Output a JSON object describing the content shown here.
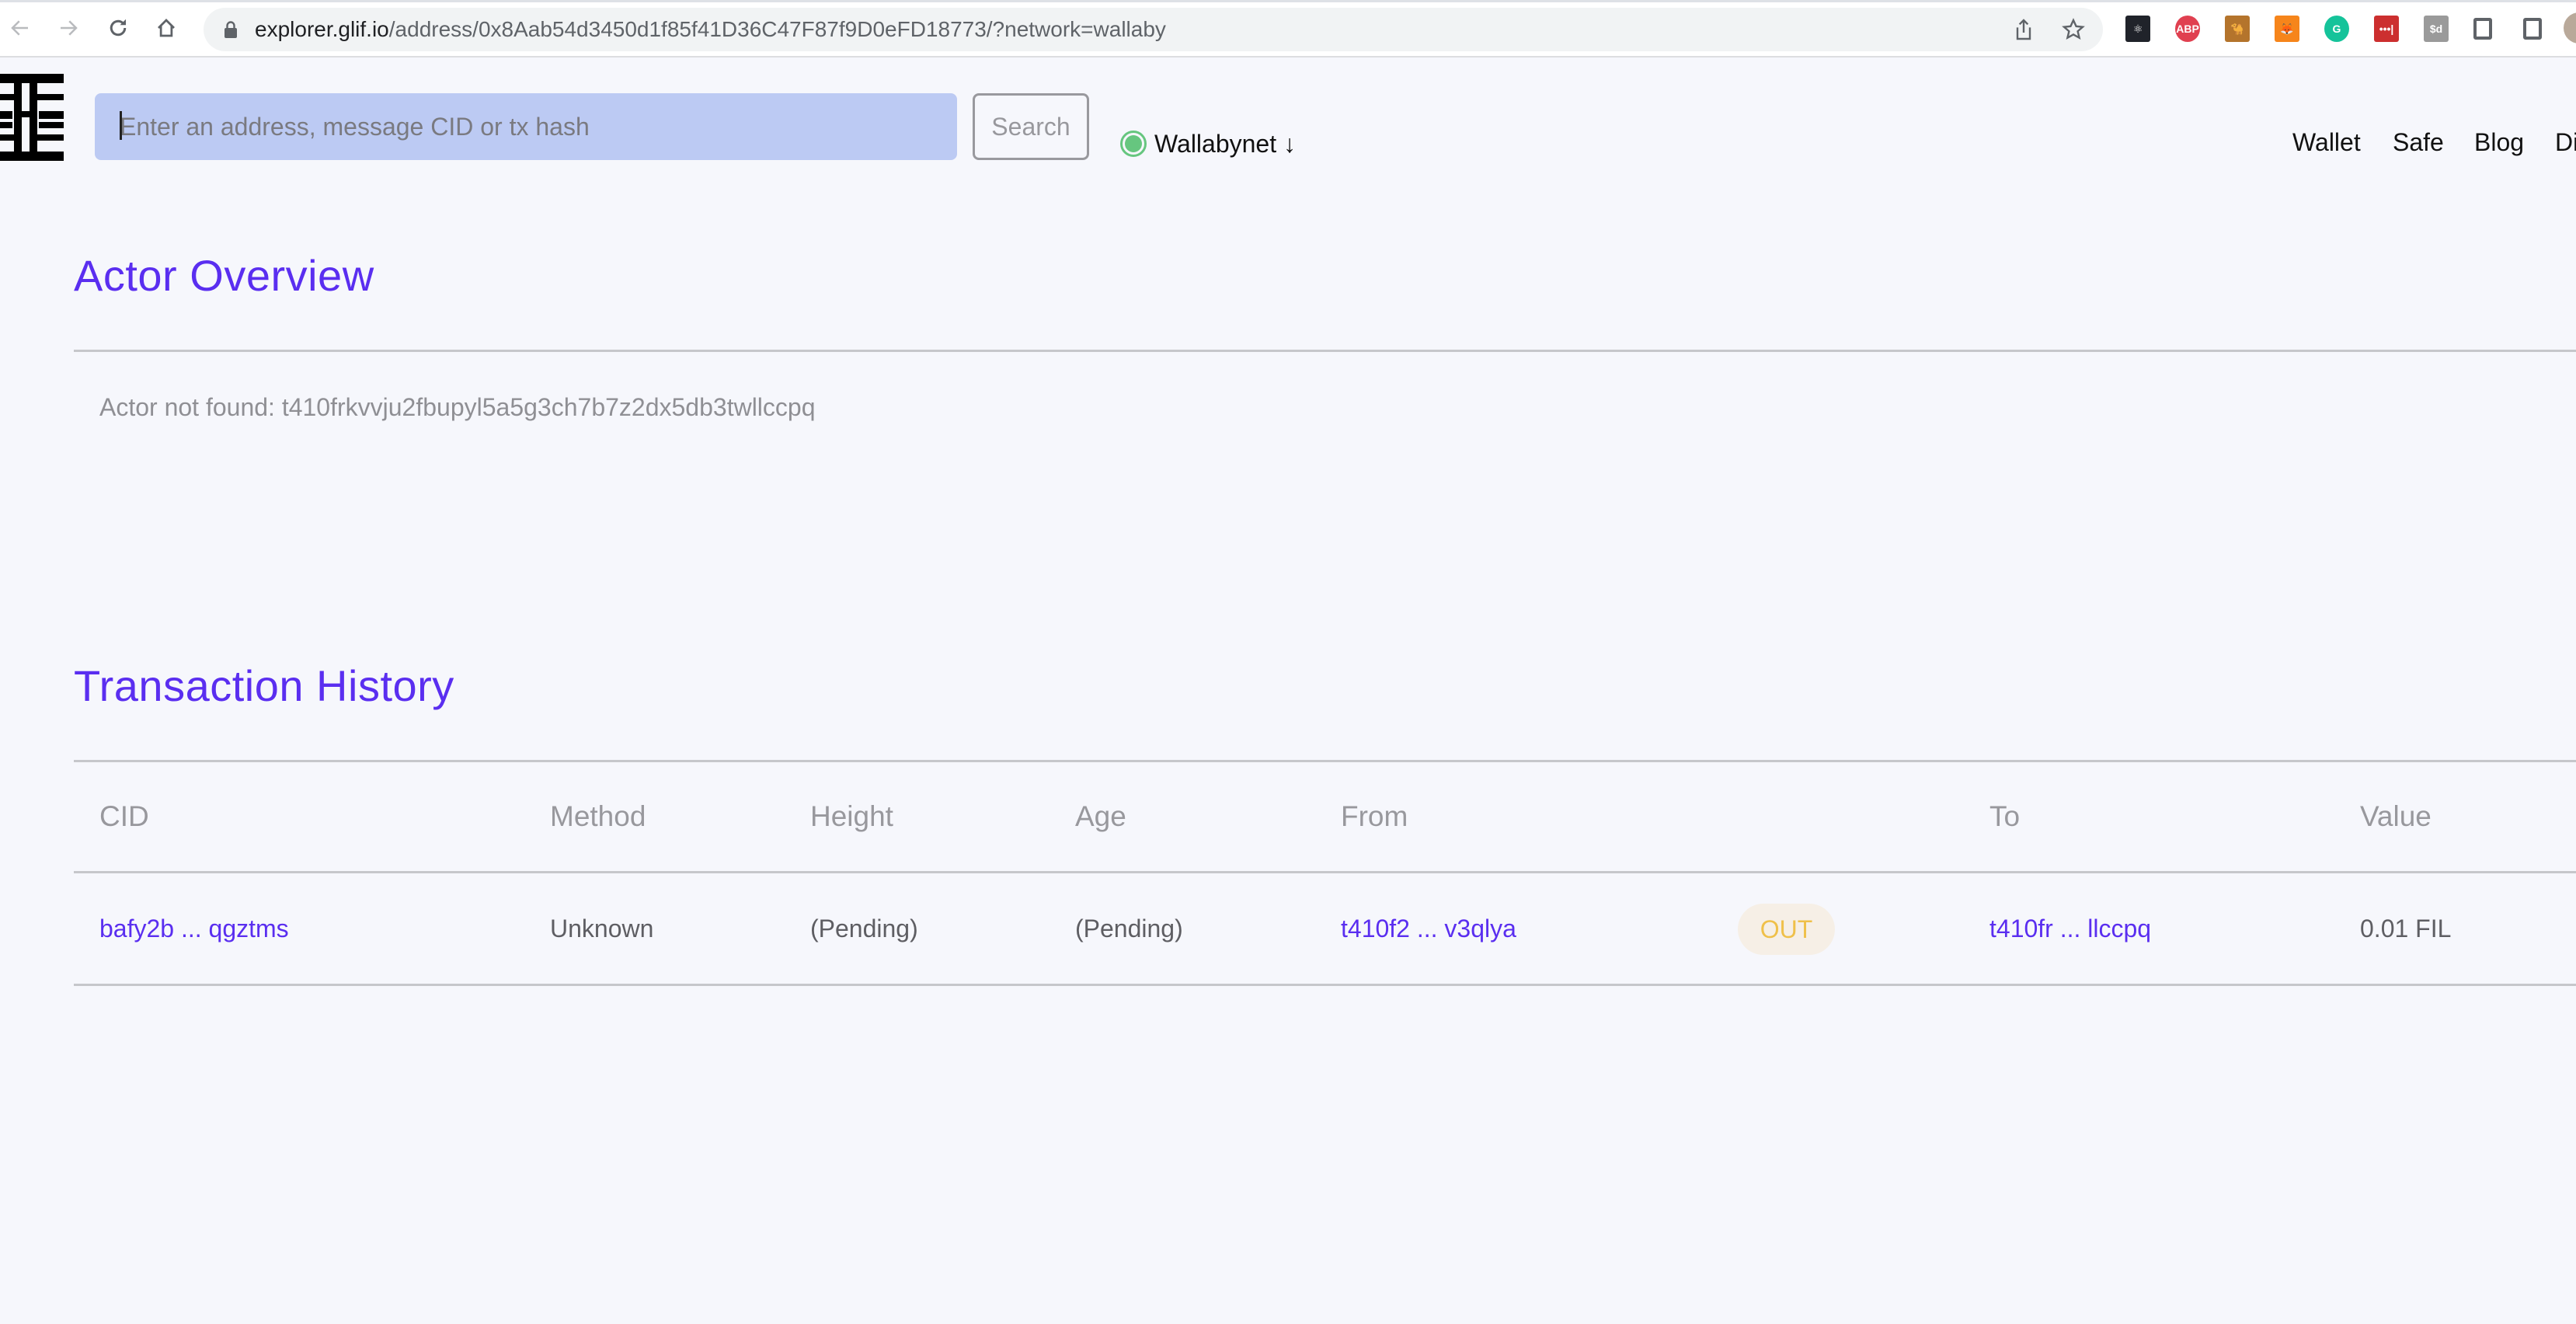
{
  "browser": {
    "url_host": "explorer.glif.io",
    "url_path": "/address/0x8Aab54d3450d1f85f41D36C47F87f9D0eFD18773/?network=wallaby",
    "extensions": [
      {
        "name": "react-devtools",
        "label": "⚛",
        "color": "#20232a"
      },
      {
        "name": "adblock-plus",
        "label": "ABP",
        "color": "#e04050"
      },
      {
        "name": "camel-notebook",
        "label": "🐪",
        "color": "#b4742c"
      },
      {
        "name": "metamask",
        "label": "🦊",
        "color": "#f6851b"
      },
      {
        "name": "grammarly",
        "label": "G",
        "color": "#15c39a"
      },
      {
        "name": "lastpass",
        "label": "•••|",
        "color": "#cc2f2f"
      },
      {
        "name": "sd-extension",
        "label": "$d",
        "color": "#9a9a9a"
      },
      {
        "name": "extensions-puzzle",
        "label": "",
        "color": "#5f6368"
      },
      {
        "name": "sidebar-panel",
        "label": "",
        "color": "#5f6368"
      }
    ]
  },
  "header": {
    "search_placeholder": "Enter an address, message CID or tx hash",
    "search_button": "Search",
    "network": "Wallabynet ↓",
    "nav": [
      "Wallet",
      "Safe",
      "Blog",
      "Di"
    ]
  },
  "actor_overview": {
    "title": "Actor Overview",
    "message": "Actor not found: t410frkvvju2fbupyl5a5g3ch7b7z2dx5db3twllccpq"
  },
  "transaction_history": {
    "title": "Transaction History",
    "columns": [
      "CID",
      "Method",
      "Height",
      "Age",
      "From",
      "To",
      "Value"
    ],
    "rows": [
      {
        "cid": "bafy2b ... qgztms",
        "method": "Unknown",
        "height": "(Pending)",
        "age": "(Pending)",
        "from": "t410f2 ... v3qlya",
        "direction": "OUT",
        "to": "t410fr ... llccpq",
        "value": "0.01 FIL"
      }
    ]
  },
  "colors": {
    "accent": "#5a2ef0",
    "background": "#f6f7fc",
    "search_bg": "#bccaf3",
    "network_status": "#66c67f",
    "out_badge_text": "#efc04a",
    "out_badge_bg": "#f6efe6"
  }
}
